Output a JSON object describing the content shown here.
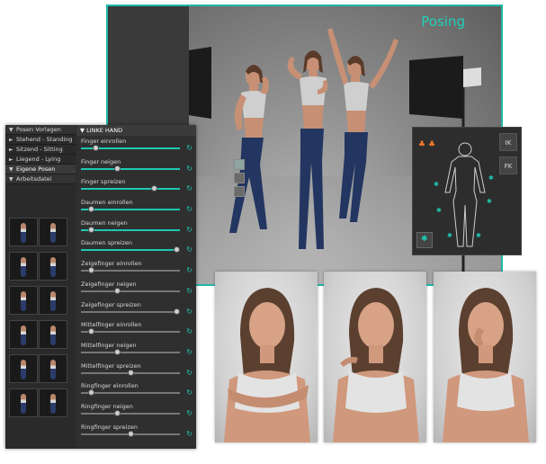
{
  "viewport": {
    "title": "Posing"
  },
  "preset_panel": {
    "rows": [
      {
        "label": "Posen Vorlagen",
        "arrow": "▼",
        "kind": "head"
      },
      {
        "label": "Stehend - Standing",
        "arrow": "►",
        "kind": "item"
      },
      {
        "label": "Sitzend - Sitting",
        "arrow": "►",
        "kind": "item"
      },
      {
        "label": "Liegend - Lying",
        "arrow": "►",
        "kind": "item"
      },
      {
        "label": "Eigene Posen",
        "arrow": "▼",
        "kind": "section"
      },
      {
        "label": "Arbeitsdatei",
        "arrow": "▼",
        "kind": "head"
      }
    ]
  },
  "slider_panel": {
    "header": "LINKE HAND",
    "header_arrow": "▼",
    "reset_icon": "↻",
    "sliders": [
      {
        "label": "Finger einrollen",
        "value": 0.15,
        "active": true
      },
      {
        "label": "Finger neigen",
        "value": 0.37,
        "active": true
      },
      {
        "label": "Finger spreizen",
        "value": 0.74,
        "active": true
      },
      {
        "label": "Daumen einrollen",
        "value": 0.1,
        "active": true
      },
      {
        "label": "Daumen neigen",
        "value": 0.1,
        "active": true
      },
      {
        "label": "Daumen spreizen",
        "value": 0.97,
        "active": true
      },
      {
        "label": "Zeigefinger einrollen",
        "value": 0.1,
        "active": false
      },
      {
        "label": "Zeigefinger neigen",
        "value": 0.37,
        "active": false
      },
      {
        "label": "Zeigefinger spreizen",
        "value": 0.97,
        "active": false
      },
      {
        "label": "Mittelfinger einrollen",
        "value": 0.1,
        "active": false
      },
      {
        "label": "Mittelfinger neigen",
        "value": 0.37,
        "active": false
      },
      {
        "label": "Mittelfinger spreizen",
        "value": 0.5,
        "active": false
      },
      {
        "label": "Ringfinger einrollen",
        "value": 0.1,
        "active": false
      },
      {
        "label": "Ringfinger neigen",
        "value": 0.37,
        "active": false
      },
      {
        "label": "Ringfinger spreizen",
        "value": 0.5,
        "active": false
      }
    ]
  },
  "ik_panel": {
    "ik_label": "IK",
    "fk_label": "FK",
    "pin_icon": "✱"
  },
  "colors": {
    "accent": "#1fc8b4",
    "orange": "#ff7a2a"
  }
}
